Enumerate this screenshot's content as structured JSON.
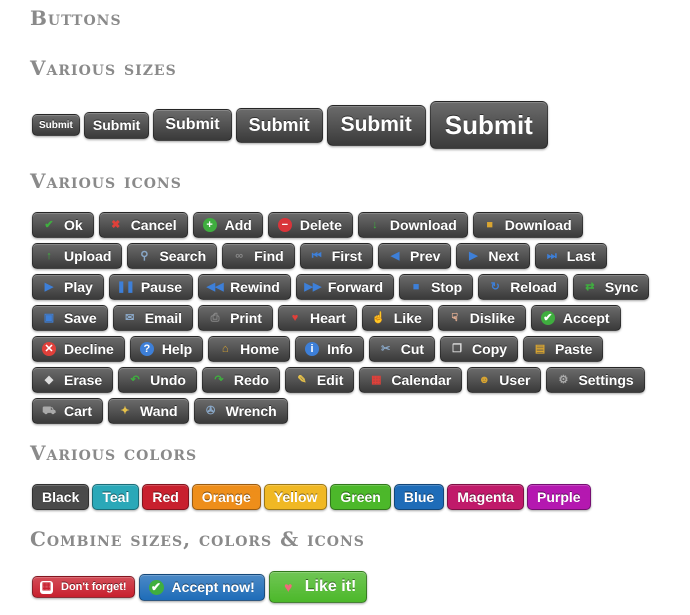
{
  "headings": {
    "main": "Buttons",
    "sizes": "Various sizes",
    "icons": "Various icons",
    "colors": "Various colors",
    "combine": "Combine sizes, colors & icons"
  },
  "sizes": [
    "Submit",
    "Submit",
    "Submit",
    "Submit",
    "Submit",
    "Submit"
  ],
  "icon_rows": [
    [
      {
        "label": "Ok",
        "icon": "check-icon",
        "color": "#3fae3f"
      },
      {
        "label": "Cancel",
        "icon": "close-icon",
        "color": "#e0403a"
      },
      {
        "label": "Add",
        "icon": "plus-circle-icon",
        "color": "#3fae3f"
      },
      {
        "label": "Delete",
        "icon": "minus-circle-icon",
        "color": "#d9343a"
      },
      {
        "label": "Download",
        "icon": "download-arrow-icon",
        "color": "#3fae3f"
      },
      {
        "label": "Download",
        "icon": "package-icon",
        "color": "#d9a531"
      }
    ],
    [
      {
        "label": "Upload",
        "icon": "upload-arrow-icon",
        "color": "#3fae3f"
      },
      {
        "label": "Search",
        "icon": "magnifier-icon",
        "color": "#8aa8c8"
      },
      {
        "label": "Find",
        "icon": "binoculars-icon",
        "color": "#888888"
      },
      {
        "label": "First",
        "icon": "first-icon",
        "color": "#3d7fd8"
      },
      {
        "label": "Prev",
        "icon": "prev-icon",
        "color": "#3d7fd8"
      },
      {
        "label": "Next",
        "icon": "next-icon",
        "color": "#3d7fd8"
      },
      {
        "label": "Last",
        "icon": "last-icon",
        "color": "#3d7fd8"
      }
    ],
    [
      {
        "label": "Play",
        "icon": "play-icon",
        "color": "#3d7fd8"
      },
      {
        "label": "Pause",
        "icon": "pause-icon",
        "color": "#3d7fd8"
      },
      {
        "label": "Rewind",
        "icon": "rewind-icon",
        "color": "#3d7fd8"
      },
      {
        "label": "Forward",
        "icon": "forward-icon",
        "color": "#3d7fd8"
      },
      {
        "label": "Stop",
        "icon": "stop-icon",
        "color": "#3d7fd8"
      },
      {
        "label": "Reload",
        "icon": "reload-icon",
        "color": "#3d7fd8"
      },
      {
        "label": "Sync",
        "icon": "sync-icon",
        "color": "#3fae3f"
      }
    ],
    [
      {
        "label": "Save",
        "icon": "floppy-icon",
        "color": "#3d7fd8"
      },
      {
        "label": "Email",
        "icon": "envelope-icon",
        "color": "#8aa8c8"
      },
      {
        "label": "Print",
        "icon": "printer-icon",
        "color": "#888888"
      },
      {
        "label": "Heart",
        "icon": "heart-icon",
        "color": "#e0403a"
      },
      {
        "label": "Like",
        "icon": "thumbs-up-icon",
        "color": "#f2b89a"
      },
      {
        "label": "Dislike",
        "icon": "thumbs-down-icon",
        "color": "#f2b89a"
      },
      {
        "label": "Accept",
        "icon": "check-circle-icon",
        "color": "#3fae3f"
      }
    ],
    [
      {
        "label": "Decline",
        "icon": "x-circle-icon",
        "color": "#e0403a"
      },
      {
        "label": "Help",
        "icon": "question-circle-icon",
        "color": "#3d7fd8"
      },
      {
        "label": "Home",
        "icon": "house-icon",
        "color": "#d9a531"
      },
      {
        "label": "Info",
        "icon": "info-circle-icon",
        "color": "#3d7fd8"
      },
      {
        "label": "Cut",
        "icon": "scissors-icon",
        "color": "#8aa8c8"
      },
      {
        "label": "Copy",
        "icon": "copy-icon",
        "color": "#dddddd"
      },
      {
        "label": "Paste",
        "icon": "clipboard-icon",
        "color": "#d9a531"
      }
    ],
    [
      {
        "label": "Erase",
        "icon": "eraser-icon",
        "color": "#dddddd"
      },
      {
        "label": "Undo",
        "icon": "undo-icon",
        "color": "#3fae3f"
      },
      {
        "label": "Redo",
        "icon": "redo-icon",
        "color": "#3fae3f"
      },
      {
        "label": "Edit",
        "icon": "pencil-icon",
        "color": "#e6c14a"
      },
      {
        "label": "Calendar",
        "icon": "calendar-icon",
        "color": "#e0403a"
      },
      {
        "label": "User",
        "icon": "user-icon",
        "color": "#d9a531"
      },
      {
        "label": "Settings",
        "icon": "gear-icon",
        "color": "#aaaaaa"
      }
    ],
    [
      {
        "label": "Cart",
        "icon": "cart-icon",
        "color": "#aaaaaa"
      },
      {
        "label": "Wand",
        "icon": "wand-icon",
        "color": "#e6c14a"
      },
      {
        "label": "Wrench",
        "icon": "wrench-icon",
        "color": "#8aa8c8"
      }
    ]
  ],
  "colors": [
    {
      "label": "Black",
      "color": "#4a4a4a"
    },
    {
      "label": "Teal",
      "color": "#2aa8b8"
    },
    {
      "label": "Red",
      "color": "#c8202e"
    },
    {
      "label": "Orange",
      "color": "#ee8e1a"
    },
    {
      "label": "Yellow",
      "color": "#f0b824"
    },
    {
      "label": "Green",
      "color": "#4cb82a"
    },
    {
      "label": "Blue",
      "color": "#1e6cb8"
    },
    {
      "label": "Magenta",
      "color": "#c01a6a"
    },
    {
      "label": "Purple",
      "color": "#b418b0"
    }
  ],
  "combos": [
    {
      "label": "Don't forget!",
      "icon": "calendar-icon",
      "color": "#c8202e"
    },
    {
      "label": "Accept now!",
      "icon": "check-circle-icon",
      "color": "#1e6cb8"
    },
    {
      "label": "Like it!",
      "icon": "heart-icon",
      "color": "#4cb82a"
    }
  ]
}
